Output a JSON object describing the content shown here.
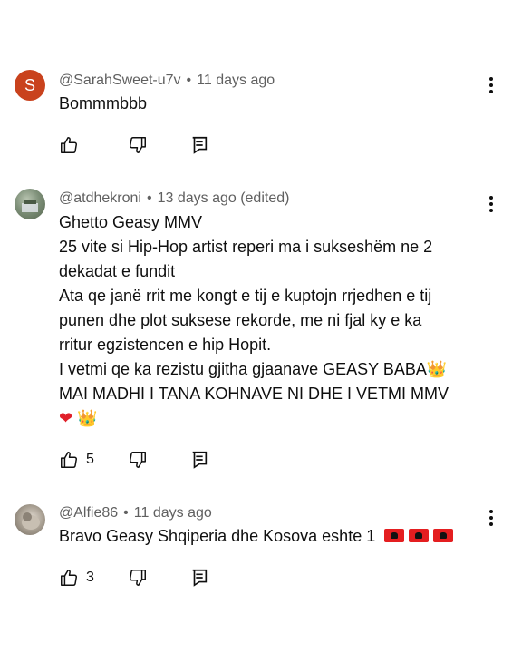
{
  "comments": [
    {
      "avatar_letter": "S",
      "avatar_color": "#c9421d",
      "author": "@SarahSweet-u7v",
      "time": "11 days ago",
      "lines": [
        "Bommmbbb"
      ],
      "likes": ""
    },
    {
      "author": "@atdhekroni",
      "time": "13 days ago (edited)",
      "lines": [
        "Ghetto Geasy MMV",
        "25 vite si Hip-Hop artist reperi ma i sukseshëm ne 2",
        "dekadat e fundit",
        "Ata qe janë rrit me kongt e tij e kuptojn rrjedhen e tij",
        "punen dhe plot suksese rekorde, me ni fjal  ky e ka",
        "rritur egzistencen e hip Hopit.",
        "I vetmi qe ka rezistu gjitha gjaanave GEASY BABA",
        "MAI MADHI I TANA KOHNAVE  NI DHE I VETMI MMV"
      ],
      "likes": "5"
    },
    {
      "author": "@Alfie86",
      "time": "11 days ago",
      "lines": [
        "Bravo Geasy Shqiperia dhe Kosova eshte 1"
      ],
      "likes": "3"
    }
  ],
  "emoji": {
    "crown": "👑",
    "heart": "❤"
  },
  "icons": {
    "like": "thumbs-up-icon",
    "dislike": "thumbs-down-icon",
    "reply": "reply-icon",
    "more": "more-vertical-icon",
    "flag": "albania-flag-icon"
  }
}
